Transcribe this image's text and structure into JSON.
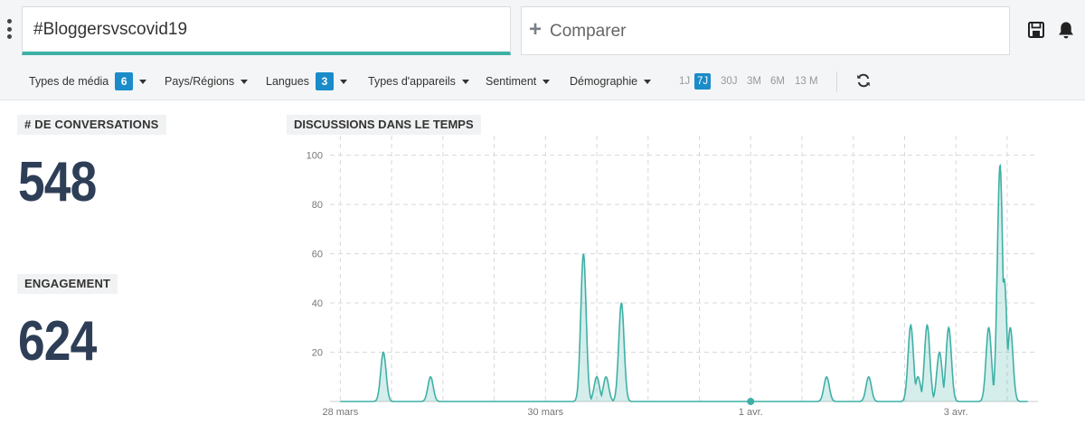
{
  "header": {
    "query": "#Bloggersvscovid19",
    "compare_label": "Comparer",
    "save_icon": "save-icon",
    "bell_icon": "bell-icon"
  },
  "filters": [
    {
      "label": "Types de média",
      "badge": "6"
    },
    {
      "label": "Pays/Régions"
    },
    {
      "label": "Langues",
      "badge": "3"
    },
    {
      "label": "Types d'appareils"
    },
    {
      "label": "Sentiment"
    },
    {
      "label": "Démographie"
    }
  ],
  "periods": [
    {
      "label": "1J"
    },
    {
      "label": "7J",
      "active": true
    },
    {
      "label": "30J"
    },
    {
      "label": "3M"
    },
    {
      "label": "6M"
    },
    {
      "label": "13 M"
    }
  ],
  "stats": {
    "conversations_label": "# DE CONVERSATIONS",
    "conversations_value": "548",
    "engagement_label": "ENGAGEMENT",
    "engagement_value": "624"
  },
  "colors": {
    "accent": "#3fb0a6",
    "badge": "#1a8cc9",
    "stat_value": "#2e3e57"
  },
  "chart_data": {
    "type": "area",
    "title": "DISCUSSIONS DANS LE TEMPS",
    "x_ticks": [
      "28 mars",
      "30 mars",
      "1 avr.",
      "3 avr."
    ],
    "y_ticks": [
      20,
      40,
      60,
      80,
      100
    ],
    "ylim": [
      0,
      105
    ],
    "xlim_days": [
      -0.1,
      6.8
    ],
    "grid": true,
    "spikes": [
      {
        "day": 0.42,
        "value": 20
      },
      {
        "day": 0.88,
        "value": 10
      },
      {
        "day": 2.37,
        "value": 60
      },
      {
        "day": 2.5,
        "value": 10
      },
      {
        "day": 2.59,
        "value": 10
      },
      {
        "day": 2.74,
        "value": 40
      },
      {
        "day": 4.74,
        "value": 10
      },
      {
        "day": 5.15,
        "value": 10
      },
      {
        "day": 5.56,
        "value": 31
      },
      {
        "day": 5.63,
        "value": 10
      },
      {
        "day": 5.72,
        "value": 31
      },
      {
        "day": 5.84,
        "value": 20
      },
      {
        "day": 5.93,
        "value": 30
      },
      {
        "day": 6.32,
        "value": 30
      },
      {
        "day": 6.43,
        "value": 96
      },
      {
        "day": 6.47,
        "value": 50
      },
      {
        "day": 6.53,
        "value": 30
      }
    ],
    "marker_day": 4.0
  }
}
